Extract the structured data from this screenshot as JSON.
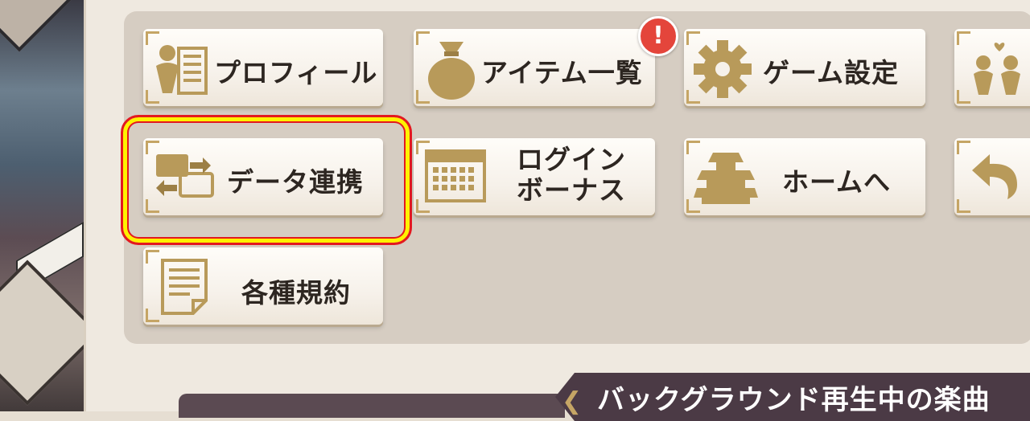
{
  "menu": {
    "profile": {
      "label": "プロフィール",
      "icon": "profile-icon"
    },
    "items": {
      "label": "アイテム一覧",
      "icon": "bag-icon",
      "badge": "!"
    },
    "settings": {
      "label": "ゲーム設定",
      "icon": "gear-icon"
    },
    "friends": {
      "label": "",
      "icon": "people-icon"
    },
    "data_link": {
      "label": "データ連携",
      "icon": "transfer-icon",
      "highlighted": true
    },
    "login_bonus": {
      "label_line1": "ログイン",
      "label_line2": "ボーナス",
      "icon": "calendar-icon"
    },
    "home": {
      "label": "ホームへ",
      "icon": "castle-icon"
    },
    "back": {
      "label": "",
      "icon": "back-arrow-icon"
    },
    "terms": {
      "label": "各種規約",
      "icon": "document-icon"
    }
  },
  "music": {
    "title": "バックグラウンド再生中の楽曲"
  },
  "colors": {
    "accent_gold": "#b89a5a",
    "highlight_red": "#e3191f",
    "highlight_yellow": "#fff200",
    "badge_red": "#e4453b",
    "music_bar": "#4b3a45"
  }
}
